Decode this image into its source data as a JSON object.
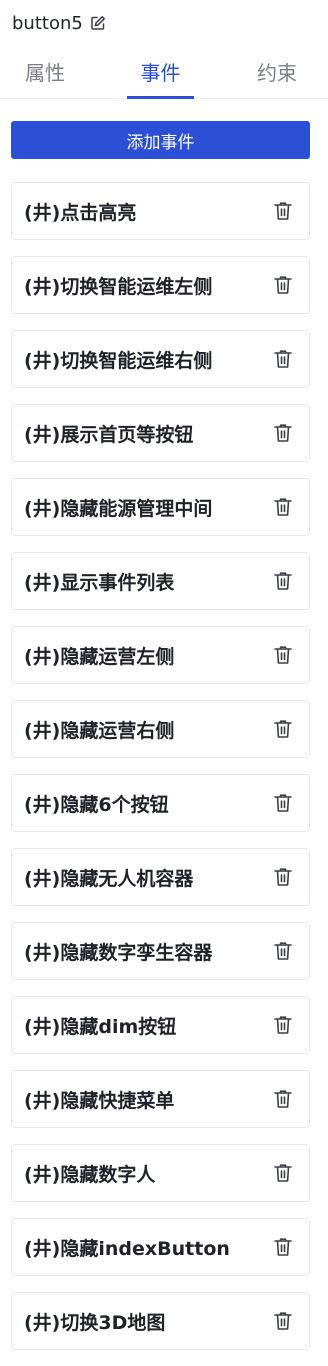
{
  "header": {
    "title": "button5",
    "edit_icon": "edit-icon"
  },
  "tabs": [
    {
      "label": "属性",
      "active": false
    },
    {
      "label": "事件",
      "active": true
    },
    {
      "label": "约束",
      "active": false
    }
  ],
  "add_event_button": {
    "label": "添加事件"
  },
  "events": [
    {
      "label": "(井)点击高亮"
    },
    {
      "label": "(井)切换智能运维左侧"
    },
    {
      "label": "(井)切换智能运维右侧"
    },
    {
      "label": "(井)展示首页等按钮"
    },
    {
      "label": "(井)隐藏能源管理中间"
    },
    {
      "label": "(井)显示事件列表"
    },
    {
      "label": "(井)隐藏运营左侧"
    },
    {
      "label": "(井)隐藏运营右侧"
    },
    {
      "label": "(井)隐藏6个按钮"
    },
    {
      "label": "(井)隐藏无人机容器"
    },
    {
      "label": "(井)隐藏数字孪生容器"
    },
    {
      "label": "(井)隐藏dim按钮"
    },
    {
      "label": "(井)隐藏快捷菜单"
    },
    {
      "label": "(井)隐藏数字人"
    },
    {
      "label": "(井)隐藏indexButton"
    },
    {
      "label": "(井)切换3D地图"
    }
  ],
  "icons": {
    "delete": "trash-icon"
  },
  "colors": {
    "accent": "#2b4fd6",
    "text": "#1f2329",
    "muted": "#7a7f87",
    "border": "#e6e8ec"
  }
}
